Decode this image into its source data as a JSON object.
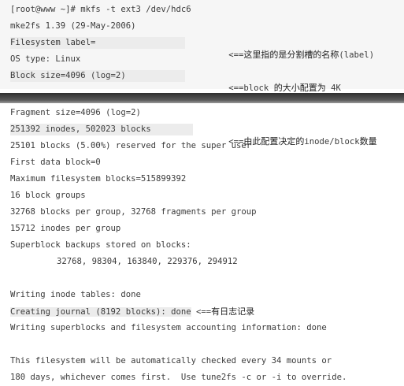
{
  "top": {
    "lines": [
      "[root@www ~]# mkfs -t ext3 /dev/hdc6",
      "mke2fs 1.39 (29-May-2006)",
      "Filesystem label=",
      "OS type: Linux",
      "Block size=4096 (log=2)"
    ],
    "annotations": {
      "label_prefix": "<==",
      "label_cn": "这里指的是分割槽的名称",
      "label_suffix": "(label)",
      "block_prefix": "<==block",
      "block_cn": "的大小配置为",
      "block_suffix": "4K"
    }
  },
  "bottom": {
    "lines": [
      "Fragment size=4096 (log=2)",
      "251392 inodes, 502023 blocks",
      "25101 blocks (5.00%) reserved for the super user",
      "First data block=0",
      "Maximum filesystem blocks=515899392",
      "16 block groups",
      "32768 blocks per group, 32768 fragments per group",
      "15712 inodes per group",
      "Superblock backups stored on blocks:",
      "32768, 98304, 163840, 229376, 294912",
      "Writing inode tables: done",
      "Creating journal (8192 blocks): done",
      "Writing superblocks and filesystem accounting information: done",
      "This filesystem will be automatically checked every 34 mounts or",
      "180 days, whichever comes first.  Use tune2fs -c or -i to override."
    ],
    "annotations": {
      "inode_prefix": "<==",
      "inode_cn": "由此配置决定的",
      "inode_mid": "inode/block",
      "inode_cn2": "数量",
      "journal_prefix": "<==",
      "journal_cn": "有日志记录"
    }
  },
  "colors": {
    "text": "#3a3a3a",
    "top_background": "#f6f6f6",
    "separator": "#3c3c3c"
  }
}
